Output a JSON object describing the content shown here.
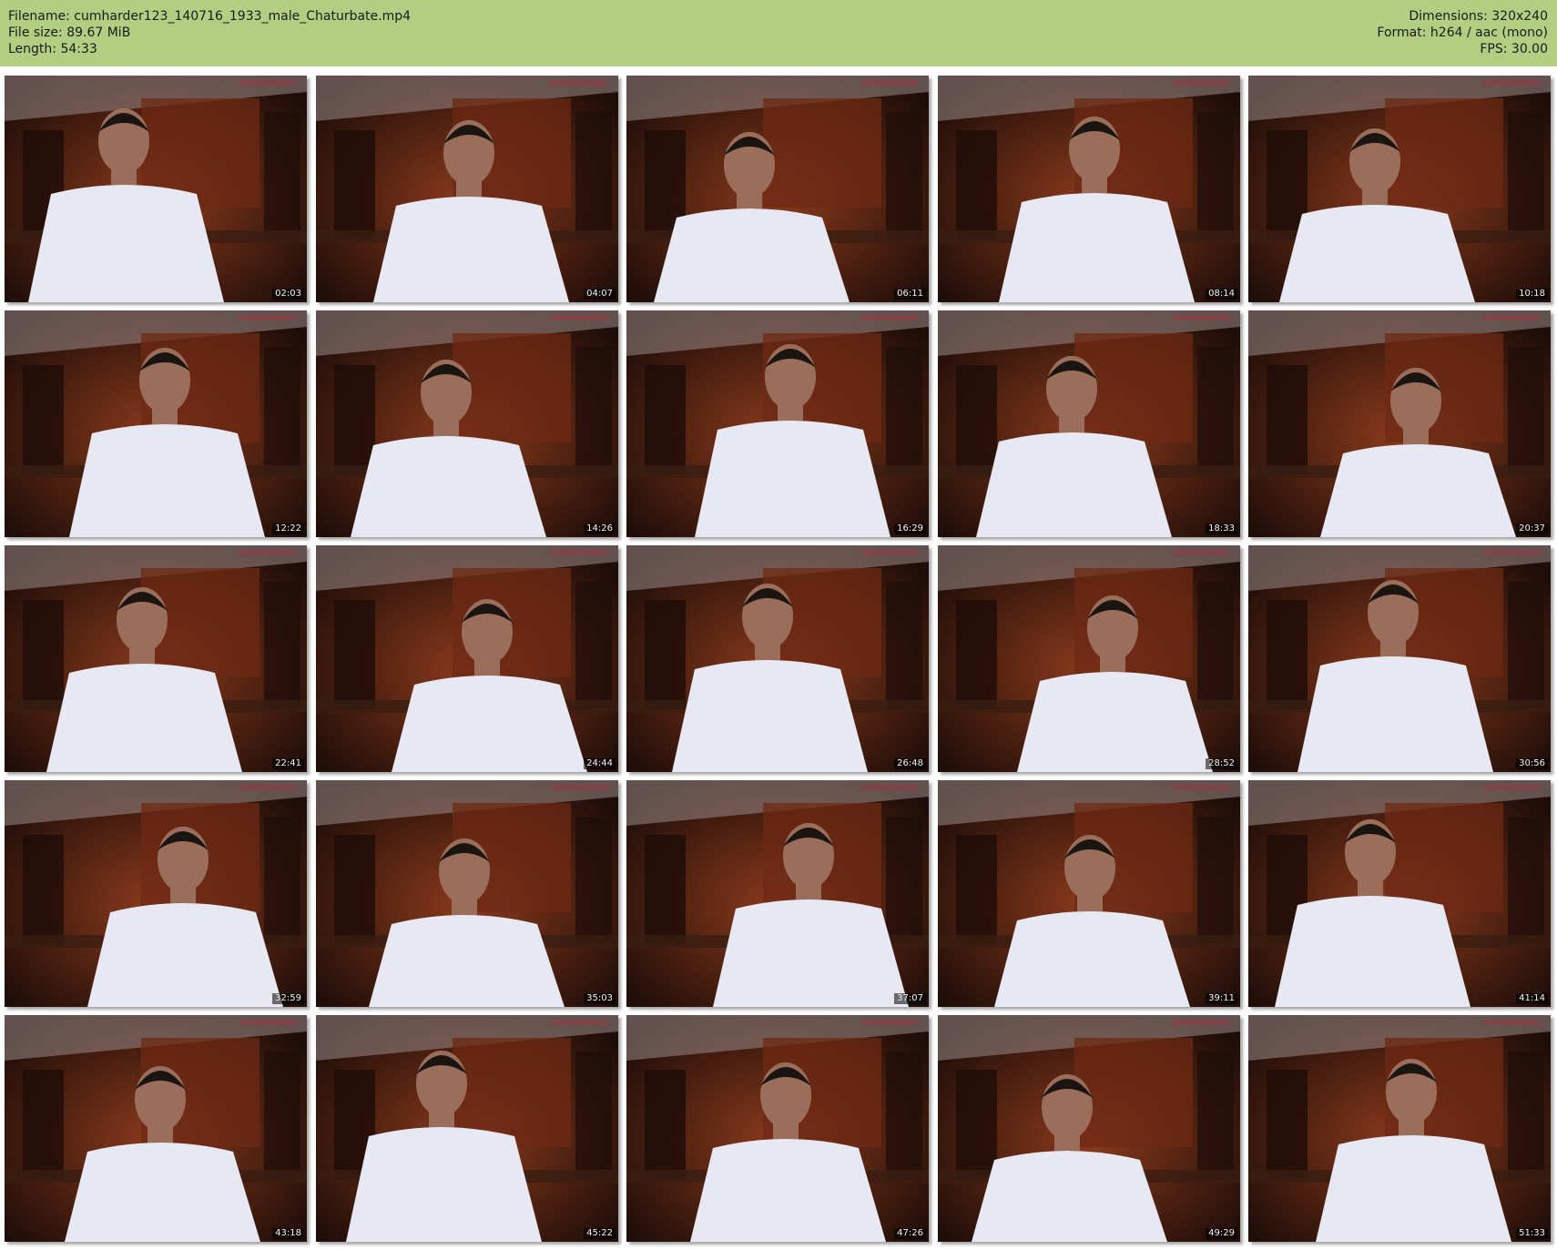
{
  "header": {
    "filename_label": "Filename: cumharder123_140716_1933_male_Chaturbate.mp4",
    "filesize_label": "File size: 89.67 MiB",
    "length_label": "Length: 54:33",
    "dimensions_label": "Dimensions: 320x240",
    "format_label": "Format: h264 / aac (mono)",
    "fps_label": "FPS: 30.00"
  },
  "colors": {
    "header_bg": "#b3ce83",
    "scene_wall": "#6e2a14",
    "scene_shelf": "#1e0d08",
    "scene_ceiling": "#9a8a88",
    "shirt": "#e8e8f2",
    "skin": "#9b6e5c",
    "hair": "#1b1512"
  },
  "thumbnails": [
    {
      "time": "02:03"
    },
    {
      "time": "04:07"
    },
    {
      "time": "06:11"
    },
    {
      "time": "08:14"
    },
    {
      "time": "10:18"
    },
    {
      "time": "12:22"
    },
    {
      "time": "14:26"
    },
    {
      "time": "16:29"
    },
    {
      "time": "18:33"
    },
    {
      "time": "20:37"
    },
    {
      "time": "22:41"
    },
    {
      "time": "24:44"
    },
    {
      "time": "26:48"
    },
    {
      "time": "28:52"
    },
    {
      "time": "30:56"
    },
    {
      "time": "32:59"
    },
    {
      "time": "35:03"
    },
    {
      "time": "37:07"
    },
    {
      "time": "39:11"
    },
    {
      "time": "41:14"
    },
    {
      "time": "43:18"
    },
    {
      "time": "45:22"
    },
    {
      "time": "47:26"
    },
    {
      "time": "49:29"
    },
    {
      "time": "51:33"
    }
  ]
}
